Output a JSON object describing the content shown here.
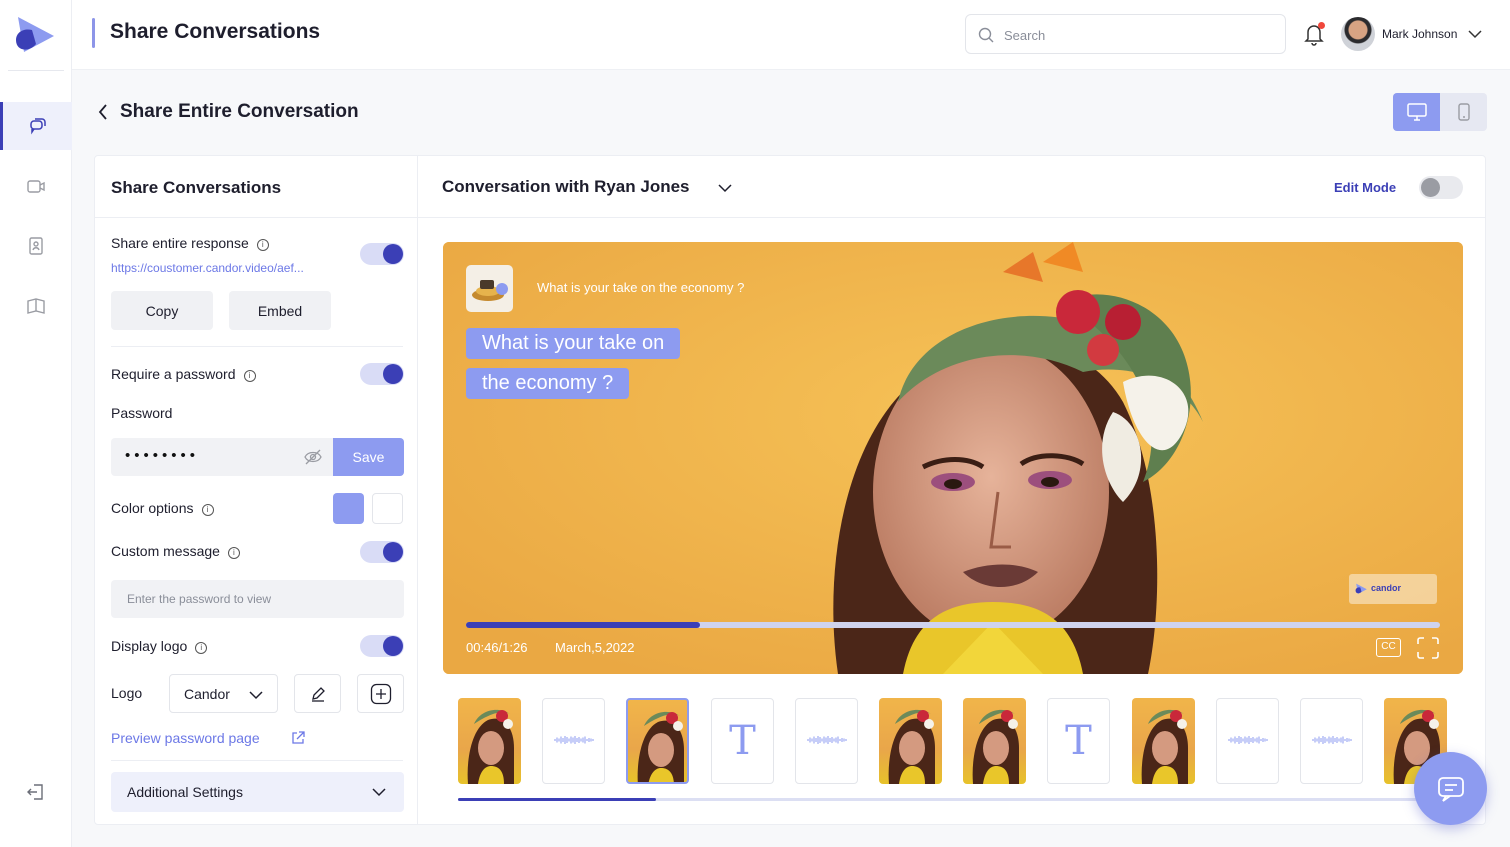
{
  "header": {
    "title": "Share Conversations",
    "search_placeholder": "Search",
    "user_name": "Mark Johnson"
  },
  "page": {
    "title": "Share Entire Conversation"
  },
  "panel": {
    "title": "Share Conversations",
    "share_response_label": "Share entire response",
    "share_link": "https://coustomer.candor.video/aef...",
    "copy_label": "Copy",
    "embed_label": "Embed",
    "require_password_label": "Require a password",
    "password_label": "Password",
    "password_value": "••••••••",
    "save_label": "Save",
    "color_options_label": "Color options",
    "colors": [
      "#8d9bf0",
      "#ffffff"
    ],
    "custom_message_label": "Custom message",
    "custom_message_placeholder": "Enter the password to view",
    "display_logo_label": "Display logo",
    "logo_label": "Logo",
    "logo_value": "Candor",
    "preview_link": "Preview password page",
    "additional_settings": "Additional Settings",
    "toggles": {
      "share_response": true,
      "require_password": true,
      "custom_message": true,
      "display_logo": true
    }
  },
  "conversation": {
    "title": "Conversation with Ryan Jones",
    "edit_mode_label": "Edit Mode",
    "edit_mode": false,
    "question": "What is your take on the economy ?",
    "caption_line1": "What is your take on",
    "caption_line2": "the economy ?",
    "watermark": "candor",
    "time": "00:46/1:26",
    "date": "March,5,2022",
    "cc_label": "CC",
    "progress_fraction": 0.24,
    "strip_scroll_fraction": 0.2
  },
  "thumbnails": [
    "photo",
    "audio",
    "photo-selected",
    "text",
    "audio",
    "photo",
    "photo",
    "text",
    "photo",
    "audio",
    "audio",
    "photo"
  ],
  "icons": [
    "logo-icon",
    "chat-icon",
    "video-icon",
    "contacts-icon",
    "book-icon",
    "logout-icon",
    "search-icon",
    "bell-icon",
    "chevron-down-icon",
    "back-icon",
    "desktop-icon",
    "mobile-icon",
    "info-icon",
    "eye-off-icon",
    "edit-icon",
    "plus-icon",
    "external-link-icon",
    "fullscreen-icon",
    "chat-bubble-icon"
  ]
}
